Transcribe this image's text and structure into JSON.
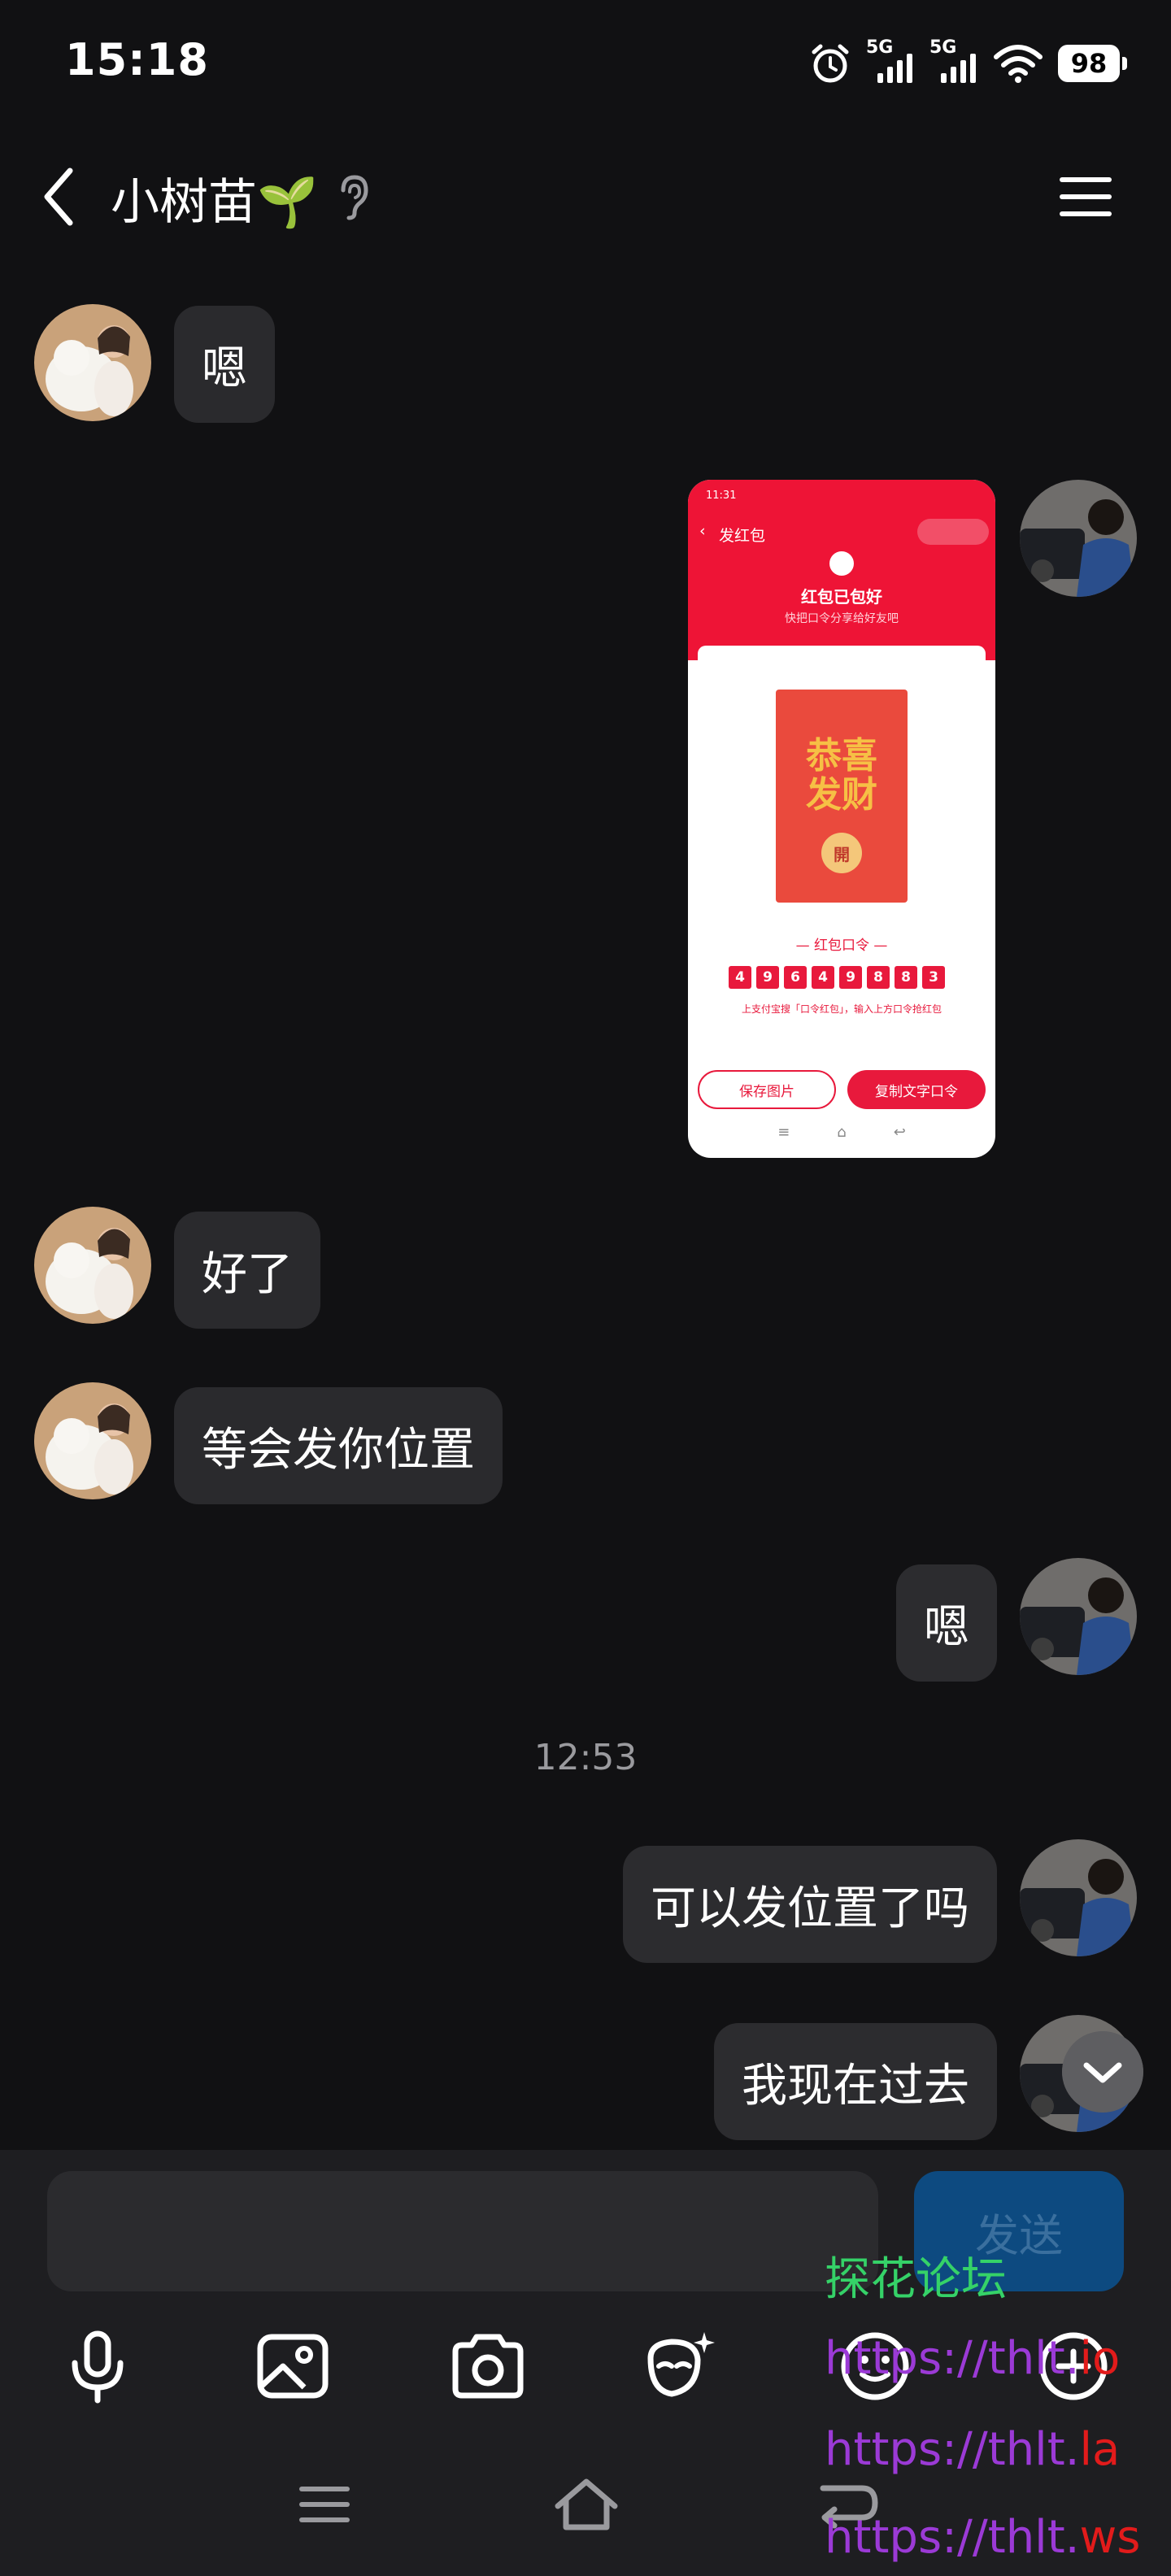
{
  "status_bar": {
    "time": "15:18",
    "network_1": "5G",
    "network_2": "5G",
    "battery": "98"
  },
  "header": {
    "title": "小树苗🌱"
  },
  "messages": [
    {
      "side": "in",
      "text": "嗯"
    },
    {
      "side": "out",
      "type": "image"
    },
    {
      "side": "in",
      "text": "好了"
    },
    {
      "side": "in",
      "text": "等会发你位置"
    },
    {
      "side": "out",
      "text": "嗯"
    },
    {
      "side": "out",
      "text": "可以发位置了吗"
    },
    {
      "side": "out",
      "text": "我现在过去"
    }
  ],
  "timestamp": "12:53",
  "image_message": {
    "status_time": "11:31",
    "nav_title": "发红包",
    "heading": "红包已包好",
    "subheading": "快把口令分享给好友吧",
    "envelope_text_1": "恭喜",
    "envelope_text_2": "发财",
    "envelope_open": "開",
    "code_title": "— 红包口令 —",
    "code_digits": [
      "4",
      "9",
      "6",
      "4",
      "9",
      "8",
      "8",
      "3"
    ],
    "note": "上支付宝搜「口令红包」，输入上方口令抢红包",
    "save_button": "保存图片",
    "copy_button": "复制文字口令"
  },
  "composer": {
    "send_label": "发送",
    "input_value": ""
  },
  "toolbar": [
    "mic-icon",
    "image-icon",
    "camera-icon",
    "sticker-icon",
    "emoji-icon",
    "plus-icon"
  ],
  "watermark": {
    "line1": "探花论坛",
    "line2_prefix": "https://thlt.",
    "line2_suffix": "io",
    "line3_prefix": "https://thlt.",
    "line3_suffix": "la",
    "line4_prefix": "https://thlt.",
    "line4_suffix": "ws"
  },
  "colors": {
    "background": "#111113",
    "bubble": "#2a2a2d",
    "send": "#0d4a80",
    "redpacket": "#ee1436"
  }
}
